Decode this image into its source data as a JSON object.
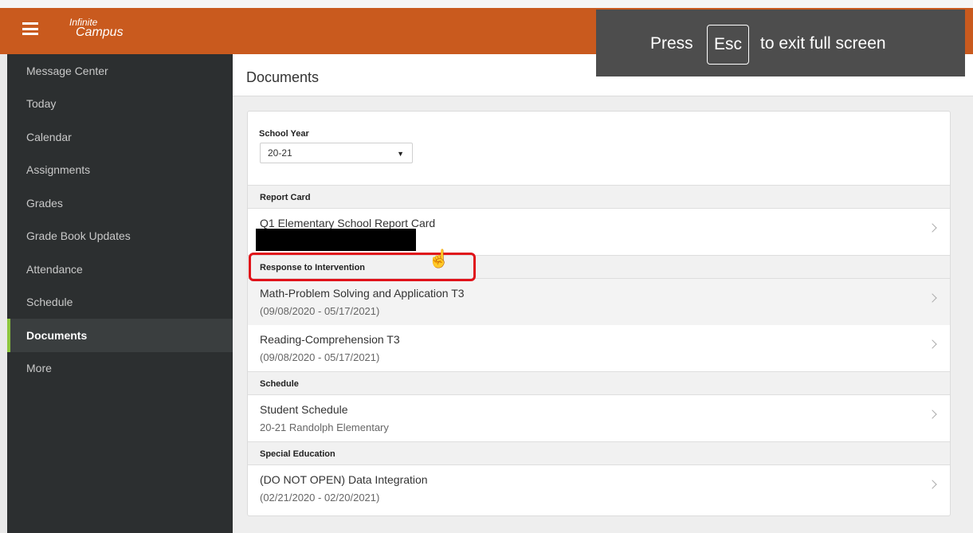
{
  "brand": {
    "line1": "Infinite",
    "line2": "Campus"
  },
  "fullscreen": {
    "press": "Press",
    "key": "Esc",
    "rest": "to exit full screen"
  },
  "sidebar": {
    "items": [
      {
        "label": "Message Center"
      },
      {
        "label": "Today"
      },
      {
        "label": "Calendar"
      },
      {
        "label": "Assignments"
      },
      {
        "label": "Grades"
      },
      {
        "label": "Grade Book Updates"
      },
      {
        "label": "Attendance"
      },
      {
        "label": "Schedule"
      },
      {
        "label": "Documents",
        "active": true
      },
      {
        "label": "More"
      }
    ]
  },
  "page": {
    "title": "Documents"
  },
  "school_year": {
    "label": "School Year",
    "value": "20-21"
  },
  "sections": [
    {
      "label": "Report Card",
      "rows": [
        {
          "title": "Q1 Elementary School Report Card",
          "sub": ""
        }
      ]
    },
    {
      "label": "Response to Intervention",
      "rows": [
        {
          "title": "Math-Problem Solving and Application T3",
          "sub": "(09/08/2020 - 05/17/2021)"
        },
        {
          "title": "Reading-Comprehension T3",
          "sub": "(09/08/2020 - 05/17/2021)"
        }
      ]
    },
    {
      "label": "Schedule",
      "rows": [
        {
          "title": "Student Schedule",
          "sub": "20-21 Randolph Elementary"
        }
      ]
    },
    {
      "label": "Special Education",
      "rows": [
        {
          "title": "(DO NOT OPEN) Data Integration",
          "sub": "(02/21/2020 - 02/20/2021)"
        }
      ]
    }
  ],
  "colors": {
    "header": "#c95a1e",
    "sidebar": "#2c2f30",
    "active_accent": "#8dc63f",
    "highlight": "#e0131a"
  },
  "icons": [
    "hamburger-menu-icon",
    "dropdown-caret-icon",
    "chevron-right-icon",
    "hand-pointer-icon"
  ]
}
